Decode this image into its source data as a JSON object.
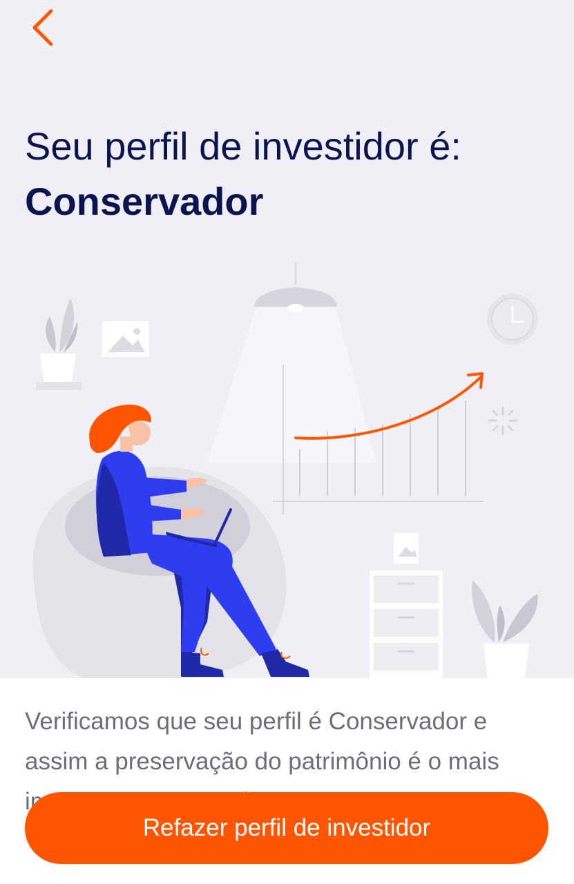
{
  "colors": {
    "background": "#f0eff5",
    "title": "#0c1450",
    "accent": "#ff5500",
    "body_text": "#6d6d78",
    "figure_blue": "#2e3df0",
    "figure_dark": "#1f29a8"
  },
  "header": {
    "back_icon": "chevron-left-icon"
  },
  "title": {
    "line1": "Seu perfil de investidor é:",
    "line2": "Conservador"
  },
  "description": "Verificamos que seu perfil é Conservador e assim a preservação do patrimônio é o mais importante para você.",
  "cta": {
    "label": "Refazer perfil de investidor"
  },
  "illustration": {
    "icons": [
      "plant-icon",
      "picture-frame-icon",
      "ceiling-lamp-icon",
      "clock-icon",
      "growth-chart-icon",
      "person-with-laptop",
      "bean-bag",
      "drawer-cabinet-icon",
      "plant-icon"
    ]
  }
}
